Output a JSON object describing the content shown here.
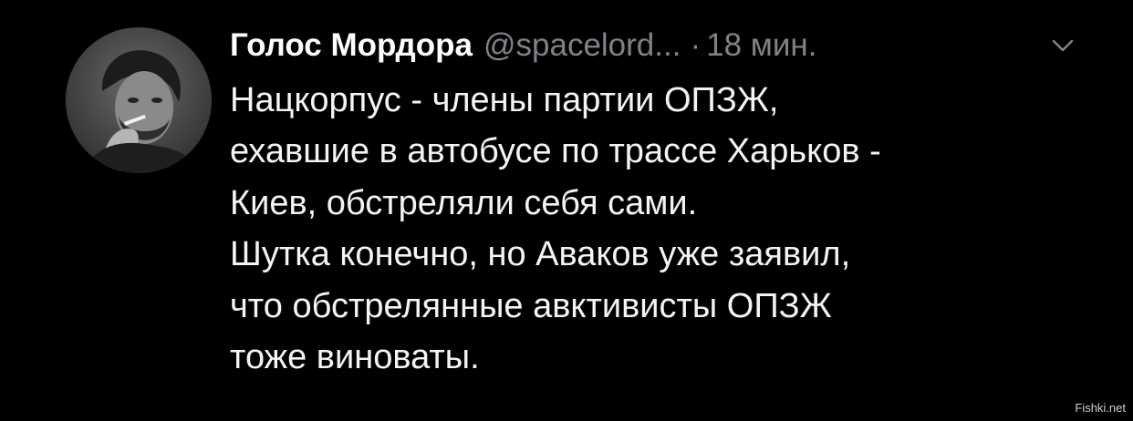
{
  "tweet": {
    "display_name": "Голос Мордора",
    "handle": "@spacelord...",
    "separator": "·",
    "time": "18 мин.",
    "menu_icon": "chevron-down-icon",
    "avatar_icon": "avatar-photo",
    "lines": [
      "Нацкорпус - члены партии ОПЗЖ,",
      "ехавшие в автобусе по трассе Харьков -",
      "Киев, обстреляли себя сами.",
      "Шутка конечно, но Аваков уже заявил,",
      "что обстрелянные авктивисты ОПЗЖ",
      "тоже виноваты."
    ]
  },
  "watermark": "Fishki.net",
  "colors": {
    "background": "#000000",
    "text": "#f4f4f4",
    "muted": "#7f8389"
  }
}
